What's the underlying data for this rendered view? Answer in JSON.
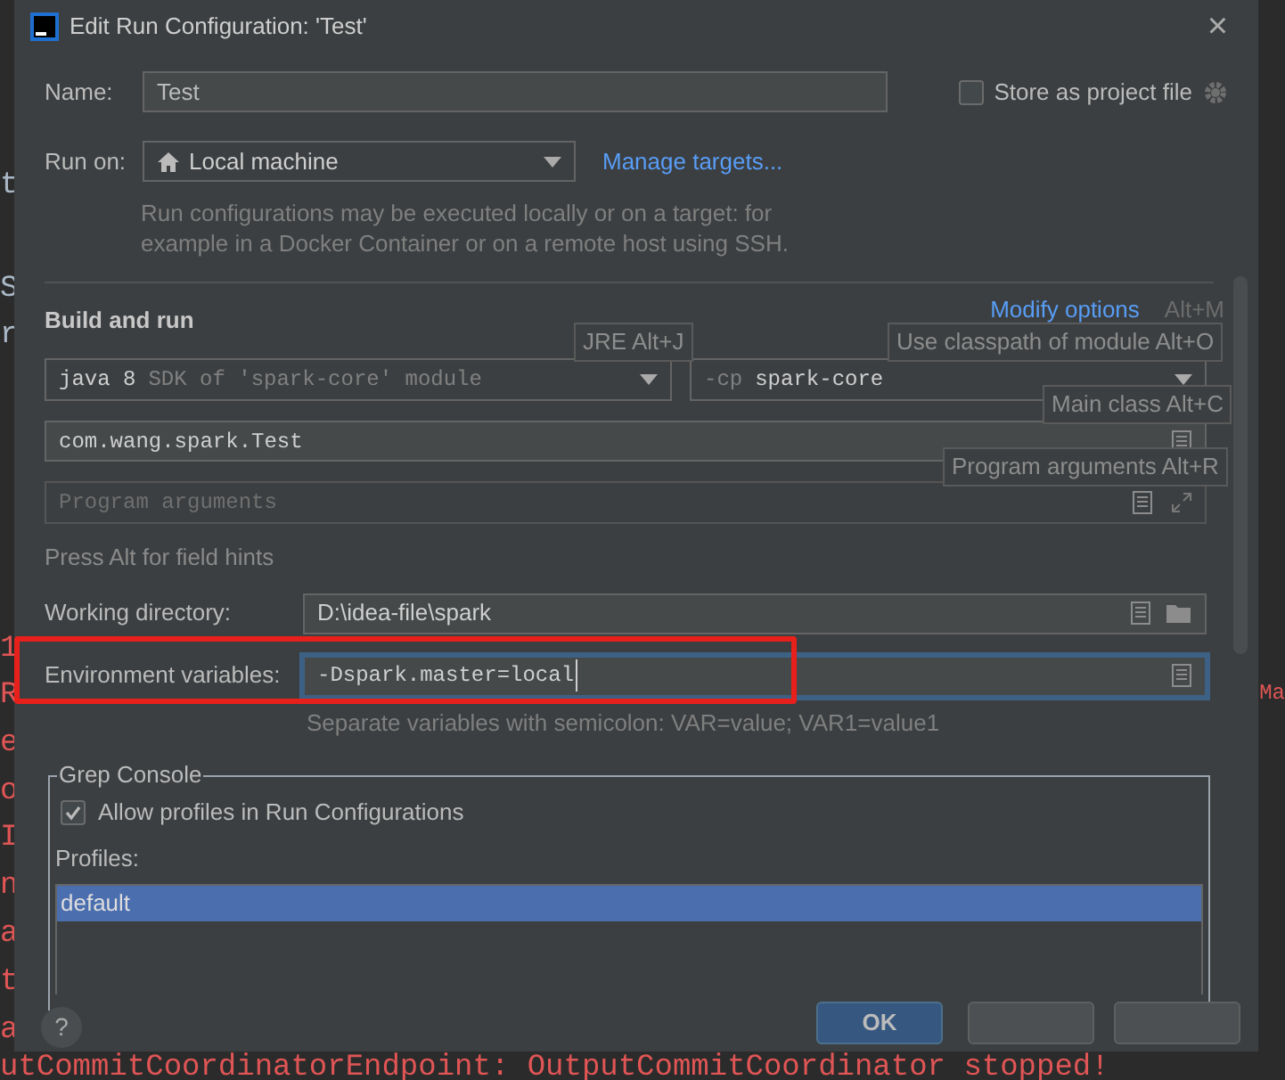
{
  "background_editor": {
    "left_fragments": [
      {
        "text": "t",
        "kind": "code"
      },
      {
        "text": "S",
        "kind": "code"
      },
      {
        "text": "r",
        "kind": "code"
      },
      {
        "text": "1",
        "kind": "error"
      },
      {
        "text": "R",
        "kind": "error"
      },
      {
        "text": "e",
        "kind": "error"
      },
      {
        "text": "o",
        "kind": "error"
      },
      {
        "text": "I",
        "kind": "error"
      },
      {
        "text": "n",
        "kind": "error"
      },
      {
        "text": "a",
        "kind": "error"
      },
      {
        "text": "t",
        "kind": "error"
      },
      {
        "text": "a",
        "kind": "error"
      }
    ],
    "right_fragment": "Ma",
    "bottom_line": "utCommitCoordinatorEndpoint: OutputCommitCoordinator stopped!"
  },
  "window": {
    "title": "Edit Run Configuration: 'Test'",
    "close": "×"
  },
  "name": {
    "label": "Name:",
    "value": "Test"
  },
  "store_as_project_file": {
    "label": "Store as project file",
    "checked": false
  },
  "run_on": {
    "label": "Run on:",
    "value": "Local machine",
    "link": "Manage targets...",
    "hint": "Run configurations may be executed locally or on a target: for example in a Docker Container or on a remote host using SSH."
  },
  "build_and_run": {
    "title": "Build and run",
    "modify_options": "Modify options",
    "modify_shortcut": "Alt+M",
    "jre": {
      "value": "java 8",
      "detail": "SDK of 'spark-core' module"
    },
    "classpath": {
      "prefix": "-cp",
      "value": "spark-core"
    },
    "main_class": {
      "value": "com.wang.spark.Test"
    },
    "program_arguments": {
      "placeholder": "Program arguments"
    },
    "tooltips": [
      {
        "text": "JRE Alt+J",
        "kind": "jre"
      },
      {
        "text": "Use classpath of module Alt+O",
        "kind": "classpath"
      },
      {
        "text": "Main class Alt+C",
        "kind": "main"
      },
      {
        "text": "Program arguments Alt+R",
        "kind": "args"
      }
    ],
    "field_hint": "Press Alt for field hints"
  },
  "working_directory": {
    "label": "Working directory:",
    "value": "D:\\idea-file\\spark"
  },
  "environment_variables": {
    "label": "Environment variables:",
    "value": "-Dspark.master=local",
    "focused": true,
    "highlighted": true,
    "hint": "Separate variables with semicolon: VAR=value; VAR1=value1"
  },
  "grep_console": {
    "title": "Grep Console",
    "allow_profiles": {
      "label": "Allow profiles in Run Configurations",
      "checked": true
    },
    "profiles_label": "Profiles:",
    "profiles": [
      {
        "name": "default",
        "selected": true
      }
    ]
  },
  "buttons": [
    {
      "label": "OK",
      "kind": "primary"
    },
    {
      "kind": "covered"
    },
    {
      "kind": "covered"
    }
  ],
  "help": "?"
}
